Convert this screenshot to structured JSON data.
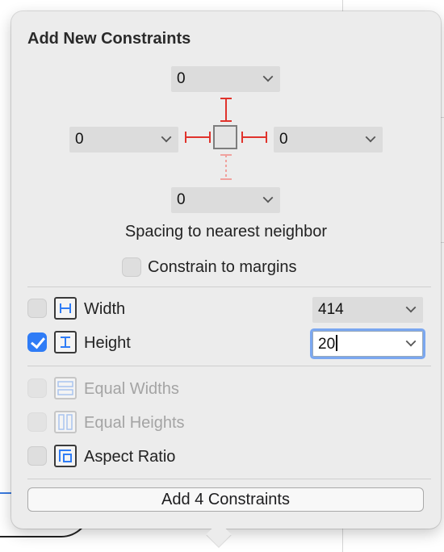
{
  "popover": {
    "title": "Add New Constraints",
    "spacing": {
      "top": "0",
      "left": "0",
      "right": "0",
      "bottom": "0",
      "caption": "Spacing to nearest neighbor"
    },
    "constrain_to_margins": {
      "label": "Constrain to margins",
      "checked": false
    },
    "width": {
      "label": "Width",
      "checked": false,
      "value": "414"
    },
    "height": {
      "label": "Height",
      "checked": true,
      "value": "20"
    },
    "equal_widths": {
      "label": "Equal Widths",
      "enabled": false
    },
    "equal_heights": {
      "label": "Equal Heights",
      "enabled": false
    },
    "aspect_ratio": {
      "label": "Aspect Ratio",
      "checked": false
    },
    "add_button_label": "Add 4 Constraints"
  },
  "colors": {
    "accent": "#2f7cf6",
    "constraint_red": "#e0332c",
    "constraint_dashed": "#f0a29e"
  }
}
